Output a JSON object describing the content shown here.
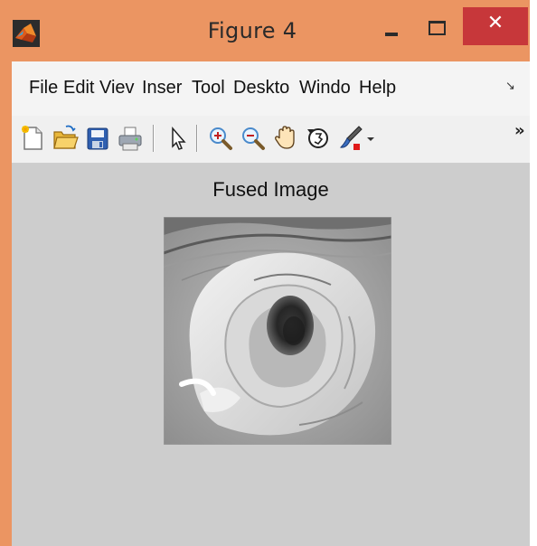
{
  "window": {
    "title": "Figure 4",
    "minimize_icon": "minimize-icon",
    "maximize_icon": "maximize-icon",
    "close_label": "✕",
    "colors": {
      "titlebar": "#eb9562",
      "close_button": "#c7373a",
      "client_background": "#cdcdcd"
    }
  },
  "menubar": {
    "items": [
      "File",
      "Edit",
      "Viev",
      "Inser",
      "Tool",
      "Deskto",
      "Windo",
      "Help"
    ],
    "more_icon": "menu-overflow-arrow-icon"
  },
  "toolbar": {
    "tools": [
      "new-figure-icon",
      "open-file-icon",
      "save-icon",
      "print-icon",
      "pointer-icon",
      "zoom-in-icon",
      "zoom-out-icon",
      "pan-hand-icon",
      "rotate-3d-icon",
      "data-cursor-brush-icon",
      "dropdown-arrow-icon"
    ],
    "overflow_label": "»"
  },
  "figure": {
    "axes_title": "Fused Image",
    "image_description_icon": "grayscale-ear-image"
  }
}
